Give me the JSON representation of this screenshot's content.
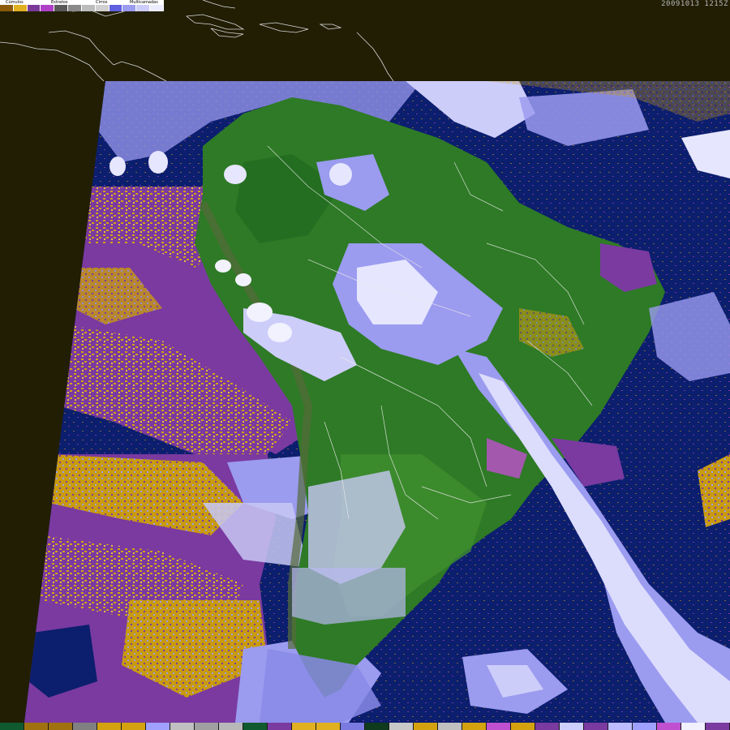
{
  "timestamp": "20091013 1215Z",
  "legend": {
    "labels": [
      "Cúmulos",
      "Estratos",
      "Cirros",
      "Multicamadas"
    ],
    "swatches": [
      "#8b5a0b",
      "#e0b020",
      "#7a3a9a",
      "#b040c8",
      "#5a5a5a",
      "#8a8a8a",
      "#bcbcbc",
      "#d0d0d0",
      "#6060e0",
      "#9b9bf0",
      "#cdcdfa",
      "#ececff"
    ]
  },
  "bottom_bar": [
    "#0f5a2e",
    "#a0720f",
    "#a0720f",
    "#808080",
    "#d4a20f",
    "#d4a20f",
    "#a0a0ff",
    "#c0c0c0",
    "#a0a0a0",
    "#b8b8b8",
    "#0f5a2e",
    "#7a3aa0",
    "#e0b020",
    "#e0b020",
    "#7a7ae0",
    "#0f3a1e",
    "#c8c8c8",
    "#d4a20f",
    "#c0c0c0",
    "#d4a20f",
    "#c050d0",
    "#d4a20f",
    "#7a3aa0",
    "#cfcfff",
    "#7a3aa0",
    "#bcbcff",
    "#a0a0ff",
    "#c050d0",
    "#f0f0ff",
    "#7a3aa0"
  ],
  "colors": {
    "background": "#211e04",
    "ocean": "#0c1e6e",
    "land": "#2e7a26",
    "cumulus": "#d4a20f",
    "stratus": "#7a3aa0",
    "cirrus_low": "#8a8ae8",
    "cirrus_high": "#e6e6ff"
  }
}
